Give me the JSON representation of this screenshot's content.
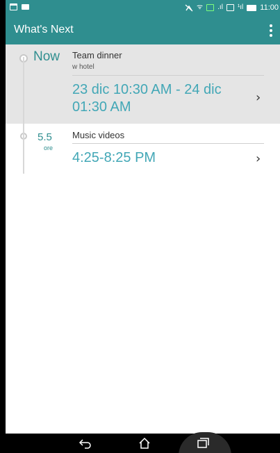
{
  "statusbar": {
    "time": "11:00",
    "glyphs": {
      "wifi": "ᯤ",
      "signal": ".ıl",
      "sim": "¹ıl"
    },
    "icons": [
      "calendar-icon",
      "message-icon",
      "mute-icon",
      "wifi-icon",
      "data-icon",
      "signal-icon",
      "sim-icon",
      "battery-icon"
    ]
  },
  "appbar": {
    "title": "What's Next",
    "menu_icon": "overflow-menu-icon"
  },
  "events": [
    {
      "when": "Now",
      "title": "Team dinner",
      "location": "w hotel",
      "time": "23 dic 10:30 AM - 24 dic 01:30 AM"
    },
    {
      "when_value": "5.5",
      "when_unit": "ore",
      "title": "Music videos",
      "time": "4:25-8:25 PM"
    }
  ],
  "chevron_glyph": "›",
  "navbar": {
    "icons": [
      "back-icon",
      "home-icon",
      "recent-apps-icon"
    ]
  },
  "colors": {
    "accent": "#2f8e8f",
    "time_text": "#42a7b6",
    "current_event_bg": "#e5e5e5"
  }
}
